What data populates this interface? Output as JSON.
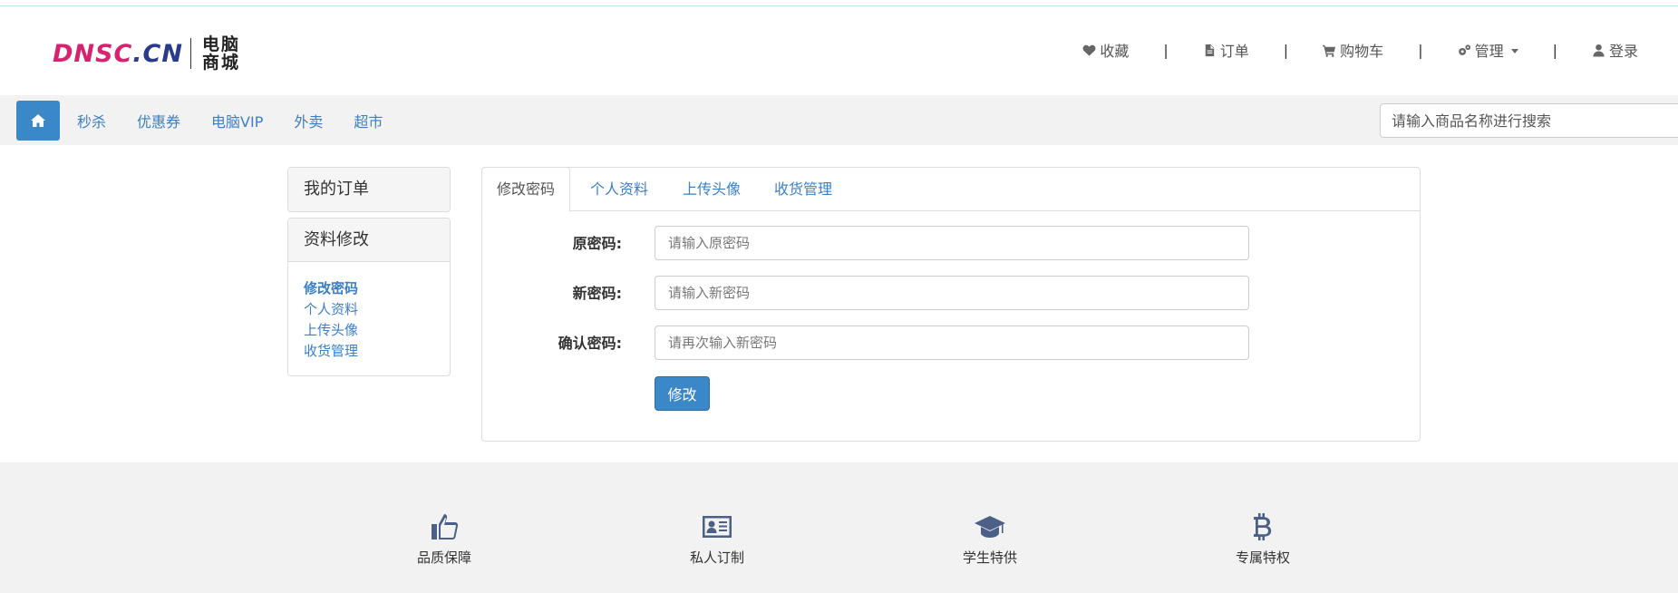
{
  "logo": {
    "main_a": "DNSC",
    "main_dot": ".",
    "main_b": "CN",
    "sub_line1": "电脑",
    "sub_line2": "商城"
  },
  "topnav": {
    "items": [
      {
        "label": "收藏",
        "icon": "heart-icon"
      },
      {
        "label": "订单",
        "icon": "document-icon"
      },
      {
        "label": "购物车",
        "icon": "cart-icon"
      },
      {
        "label": "管理",
        "icon": "gears-icon"
      },
      {
        "label": "登录",
        "icon": "user-icon"
      }
    ],
    "separator": "|"
  },
  "nav": {
    "home_icon": "home-icon",
    "links": [
      "秒杀",
      "优惠券",
      "电脑VIP",
      "外卖",
      "超市"
    ],
    "search_placeholder": "请输入商品名称进行搜索"
  },
  "sidebar": {
    "orders_title": "我的订单",
    "profile_title": "资料修改",
    "profile_links": [
      "修改密码",
      "个人资料",
      "上传头像",
      "收货管理"
    ]
  },
  "main": {
    "tabs": [
      "修改密码",
      "个人资料",
      "上传头像",
      "收货管理"
    ],
    "form": {
      "old_label": "原密码:",
      "old_placeholder": "请输入原密码",
      "new_label": "新密码:",
      "new_placeholder": "请输入新密码",
      "confirm_label": "确认密码:",
      "confirm_placeholder": "请再次输入新密码",
      "submit_label": "修改"
    }
  },
  "footer": {
    "features": [
      {
        "label": "品质保障",
        "icon": "thumbs-up-icon"
      },
      {
        "label": "私人订制",
        "icon": "id-card-icon"
      },
      {
        "label": "学生特供",
        "icon": "graduation-cap-icon"
      },
      {
        "label": "专属特权",
        "icon": "bitcoin-icon"
      }
    ]
  },
  "colors": {
    "accent": "#3b88c8",
    "link": "#3b7fc4",
    "logo_pink": "#d6226f",
    "logo_navy": "#2a3a8c"
  }
}
